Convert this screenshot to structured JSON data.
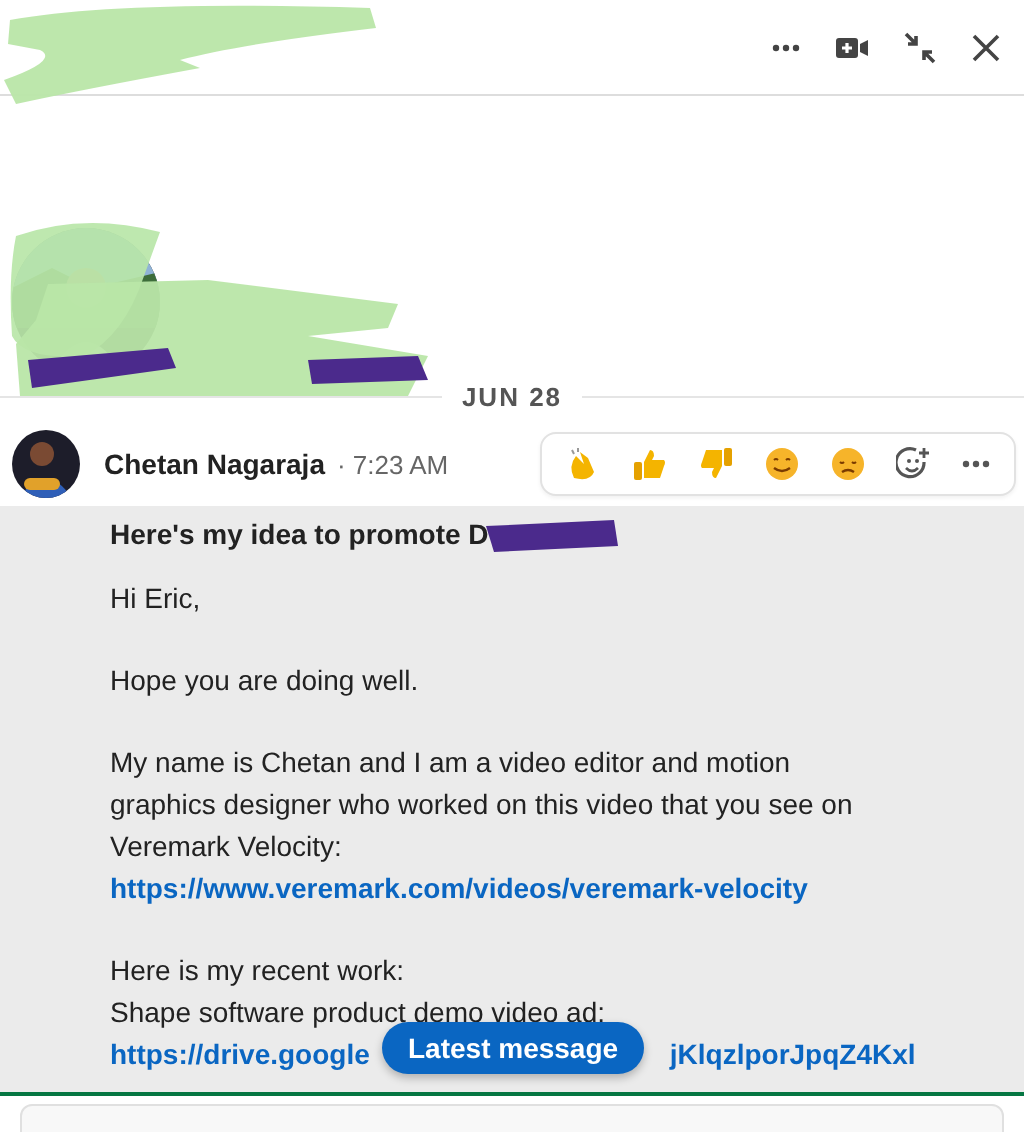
{
  "header": {
    "actions": [
      {
        "kind": "more"
      },
      {
        "kind": "video"
      },
      {
        "kind": "minimize"
      },
      {
        "kind": "close"
      }
    ]
  },
  "date_divider": "JUN 28",
  "message": {
    "sender": "Chetan Nagaraja",
    "time": "· 7:23 AM",
    "subject": "Here's my idea to promote D",
    "reactions": [
      {
        "kind": "clap"
      },
      {
        "kind": "like"
      },
      {
        "kind": "dislike"
      },
      {
        "kind": "smile"
      },
      {
        "kind": "sad"
      },
      {
        "kind": "add"
      },
      {
        "kind": "more"
      }
    ],
    "paragraphs": [
      [
        {
          "kind": "text",
          "text": "Hi Eric,"
        }
      ],
      [
        {
          "kind": "text",
          "text": "Hope you are doing well."
        }
      ],
      [
        {
          "kind": "text",
          "text": "My name is Chetan and I am a video editor and motion graphics designer who worked on this video that you see on Veremark Velocity:"
        },
        {
          "kind": "link",
          "text": "https://www.veremark.com/videos/veremark-velocity"
        }
      ],
      [
        {
          "kind": "text",
          "text": "Here is my recent work:"
        },
        {
          "kind": "text",
          "text": "Shape software product demo video ad:"
        },
        {
          "kind": "covered-link",
          "before": "https://drive.google",
          "after": "jKlqzlporJpqZ4Kxl"
        }
      ]
    ]
  },
  "latest_button": "Latest message"
}
